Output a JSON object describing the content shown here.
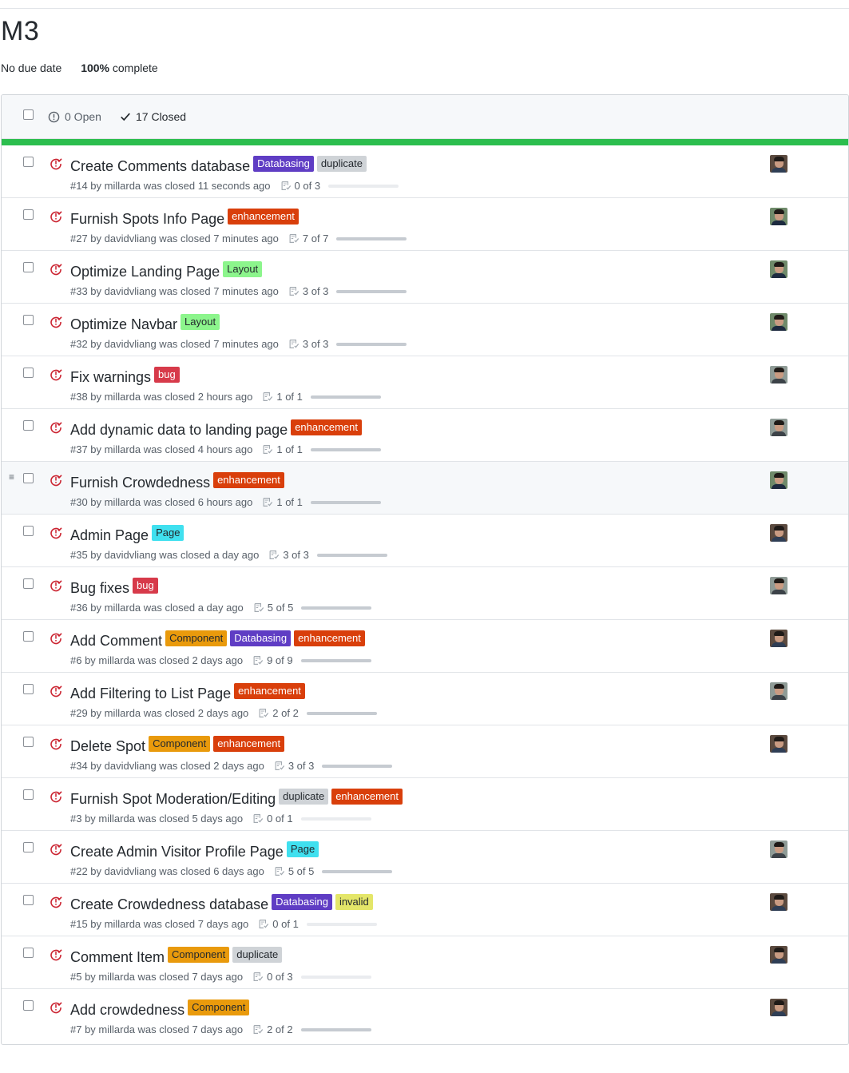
{
  "milestone": {
    "title": "M3",
    "due": "No due date",
    "percent": "100%",
    "percent_suffix": "complete"
  },
  "header": {
    "open_label": "0 Open",
    "closed_label": "17 Closed"
  },
  "colors": {
    "progress": "#2cbe4e",
    "closed_icon": "#cb2431"
  },
  "label_colors": {
    "Databasing": {
      "bg": "#5f3dc4",
      "fg": "#ffffff"
    },
    "duplicate": {
      "bg": "#cfd3d7",
      "fg": "#24292e"
    },
    "enhancement": {
      "bg": "#d93f0b",
      "fg": "#ffffff"
    },
    "Layout": {
      "bg": "#8cf58c",
      "fg": "#24292e"
    },
    "bug": {
      "bg": "#d73a4a",
      "fg": "#ffffff"
    },
    "Page": {
      "bg": "#40e0ef",
      "fg": "#24292e"
    },
    "Component": {
      "bg": "#e99a0c",
      "fg": "#24292e"
    },
    "invalid": {
      "bg": "#e4e669",
      "fg": "#24292e"
    }
  },
  "issues": [
    {
      "title": "Create Comments database",
      "labels": [
        "Databasing",
        "duplicate"
      ],
      "meta": "#14 by millarda was closed 11 seconds ago",
      "tasks": "0 of 3",
      "progress": 0,
      "avatar": "dark"
    },
    {
      "title": "Furnish Spots Info Page",
      "labels": [
        "enhancement"
      ],
      "meta": "#27 by davidvliang was closed 7 minutes ago",
      "tasks": "7 of 7",
      "progress": 1,
      "avatar": "green"
    },
    {
      "title": "Optimize Landing Page",
      "labels": [
        "Layout"
      ],
      "meta": "#33 by davidvliang was closed 7 minutes ago",
      "tasks": "3 of 3",
      "progress": 1,
      "avatar": "green"
    },
    {
      "title": "Optimize Navbar",
      "labels": [
        "Layout"
      ],
      "meta": "#32 by davidvliang was closed 7 minutes ago",
      "tasks": "3 of 3",
      "progress": 1,
      "avatar": "green"
    },
    {
      "title": "Fix warnings",
      "labels": [
        "bug"
      ],
      "meta": "#38 by millarda was closed 2 hours ago",
      "tasks": "1 of 1",
      "progress": 1,
      "avatar": "light"
    },
    {
      "title": "Add dynamic data to landing page",
      "labels": [
        "enhancement"
      ],
      "meta": "#37 by millarda was closed 4 hours ago",
      "tasks": "1 of 1",
      "progress": 1,
      "avatar": "light"
    },
    {
      "title": "Furnish Crowdedness",
      "labels": [
        "enhancement"
      ],
      "meta": "#30 by millarda was closed 6 hours ago",
      "tasks": "1 of 1",
      "progress": 1,
      "avatar": "green",
      "hover": true
    },
    {
      "title": "Admin Page",
      "labels": [
        "Page"
      ],
      "meta": "#35 by davidvliang was closed a day ago",
      "tasks": "3 of 3",
      "progress": 1,
      "avatar": "dark"
    },
    {
      "title": "Bug fixes",
      "labels": [
        "bug"
      ],
      "meta": "#36 by millarda was closed a day ago",
      "tasks": "5 of 5",
      "progress": 1,
      "avatar": "light"
    },
    {
      "title": "Add Comment",
      "labels": [
        "Component",
        "Databasing",
        "enhancement"
      ],
      "meta": "#6 by millarda was closed 2 days ago",
      "tasks": "9 of 9",
      "progress": 1,
      "avatar": "dark"
    },
    {
      "title": "Add Filtering to List Page",
      "labels": [
        "enhancement"
      ],
      "meta": "#29 by millarda was closed 2 days ago",
      "tasks": "2 of 2",
      "progress": 1,
      "avatar": "light"
    },
    {
      "title": "Delete Spot",
      "labels": [
        "Component",
        "enhancement"
      ],
      "meta": "#34 by davidvliang was closed 2 days ago",
      "tasks": "3 of 3",
      "progress": 1,
      "avatar": "dark"
    },
    {
      "title": "Furnish Spot Moderation/Editing",
      "labels": [
        "duplicate",
        "enhancement"
      ],
      "meta": "#3 by millarda was closed 5 days ago",
      "tasks": "0 of 1",
      "progress": 0,
      "avatar": ""
    },
    {
      "title": "Create Admin Visitor Profile Page",
      "labels": [
        "Page"
      ],
      "meta": "#22 by davidvliang was closed 6 days ago",
      "tasks": "5 of 5",
      "progress": 1,
      "avatar": "light"
    },
    {
      "title": "Create Crowdedness database",
      "labels": [
        "Databasing",
        "invalid"
      ],
      "meta": "#15 by millarda was closed 7 days ago",
      "tasks": "0 of 1",
      "progress": 0,
      "avatar": "dark"
    },
    {
      "title": "Comment Item",
      "labels": [
        "Component",
        "duplicate"
      ],
      "meta": "#5 by millarda was closed 7 days ago",
      "tasks": "0 of 3",
      "progress": 0,
      "avatar": "dark"
    },
    {
      "title": "Add crowdedness",
      "labels": [
        "Component"
      ],
      "meta": "#7 by millarda was closed 7 days ago",
      "tasks": "2 of 2",
      "progress": 1,
      "avatar": "dark"
    }
  ]
}
